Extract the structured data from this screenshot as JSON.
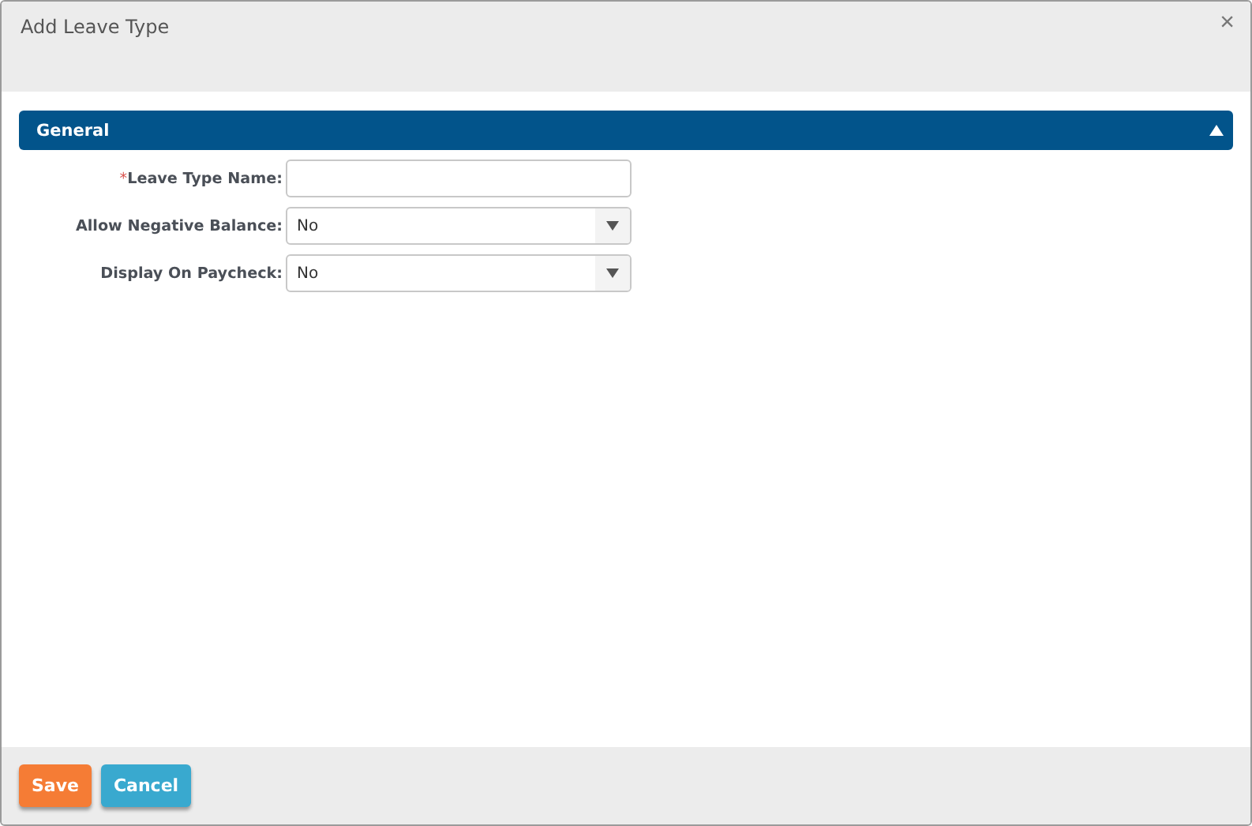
{
  "window": {
    "title": "Add Leave Type",
    "close": "×"
  },
  "section": {
    "title": "General",
    "expanded": true
  },
  "fields": [
    {
      "kind": "text",
      "label": "Leave Type Name:",
      "required_mark": "*"
    },
    {
      "kind": "select",
      "label": "Allow Negative Balance:",
      "value": "No"
    },
    {
      "kind": "select",
      "label": "Display On Paycheck:",
      "value": "No"
    }
  ],
  "buttons": [
    {
      "label": "Save",
      "kind": "primary"
    },
    {
      "label": "Cancel",
      "kind": "secondary"
    }
  ]
}
